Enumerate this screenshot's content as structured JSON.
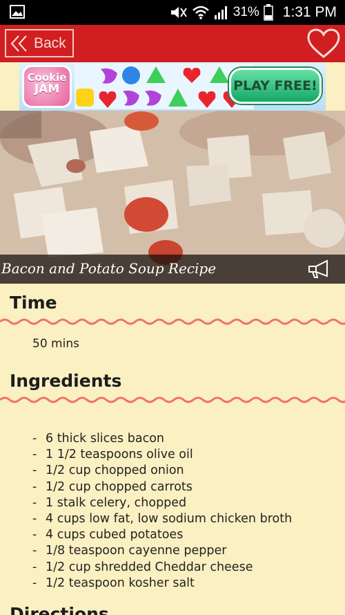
{
  "status_bar": {
    "battery_percent": "31%",
    "time": "1:31 PM",
    "icons": [
      "image-icon",
      "mute-icon",
      "wifi-icon",
      "signal-icon",
      "battery-icon"
    ]
  },
  "app_bar": {
    "back_label": "Back",
    "background_color": "#d11e21",
    "icons": [
      "double-chevron-left-icon",
      "heart-icon"
    ]
  },
  "ad": {
    "brand_line1": "Cookie",
    "brand_line2": "JAM",
    "cta_label": "PLAY FREE!"
  },
  "hero": {
    "title": "Bacon and Potato Soup Recipe",
    "icons": [
      "speaker-icon"
    ]
  },
  "sections": {
    "time": {
      "heading": "Time",
      "value": "50 mins"
    },
    "ingredients": {
      "heading": "Ingredients",
      "items": [
        "6 thick slices bacon",
        "1 1/2 teaspoons olive oil",
        "1/2 cup chopped onion",
        "1/2 cup chopped carrots",
        "1 stalk celery, chopped",
        "4 cups low fat, low sodium chicken broth",
        "4 cups cubed potatoes",
        "1/8 teaspoon cayenne pepper",
        "1/2 cup shredded Cheddar cheese",
        "1/2 teaspoon kosher salt"
      ]
    },
    "directions": {
      "heading": "Directions"
    }
  },
  "colors": {
    "background": "#fbf0c2",
    "accent": "#d11e21",
    "wave": "#ef7266"
  }
}
